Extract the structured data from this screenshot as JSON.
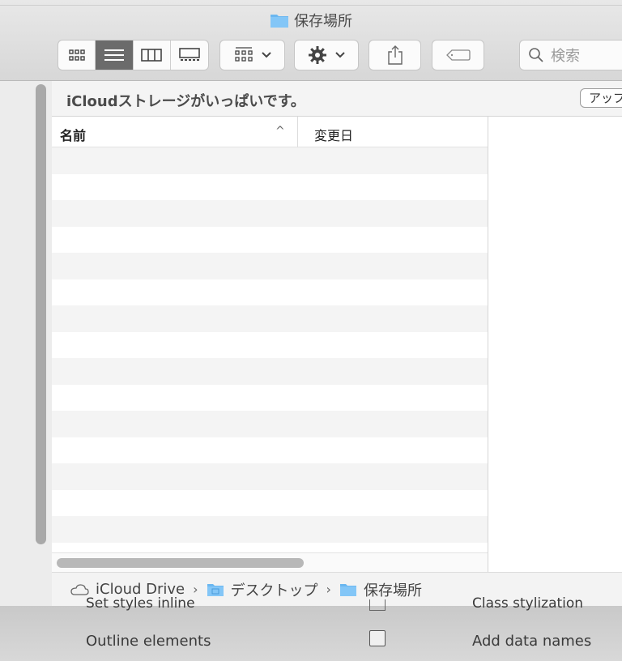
{
  "window": {
    "title": "保存場所"
  },
  "toolbar": {
    "search_placeholder": "検索"
  },
  "banner": {
    "message": "iCloudストレージがいっぱいです。",
    "upgrade_label": "アップ"
  },
  "list": {
    "col_name": "名前",
    "col_date": "変更日"
  },
  "pathbar": {
    "items": [
      "iCloud Drive",
      "デスクトップ",
      "保存場所"
    ]
  },
  "bottom_panel": {
    "peek_left": "Set styles inline",
    "peek_right": "Class stylization",
    "outline_label": "Outline elements",
    "add_names_label": "Add data names"
  },
  "colors": {
    "folder_blue": "#6bb7f0",
    "active_view_bg": "#6b6b6b",
    "stripe": "#f4f4f4"
  },
  "icons": {
    "view_icons": [
      "icon-view-icon",
      "list-view-icon",
      "column-view-icon",
      "gallery-view-icon"
    ],
    "group": "group-icon",
    "action": "gear-icon",
    "share": "share-icon",
    "tag": "tag-icon",
    "search": "search-icon",
    "cloud": "cloud-icon",
    "folder": "folder-icon"
  }
}
